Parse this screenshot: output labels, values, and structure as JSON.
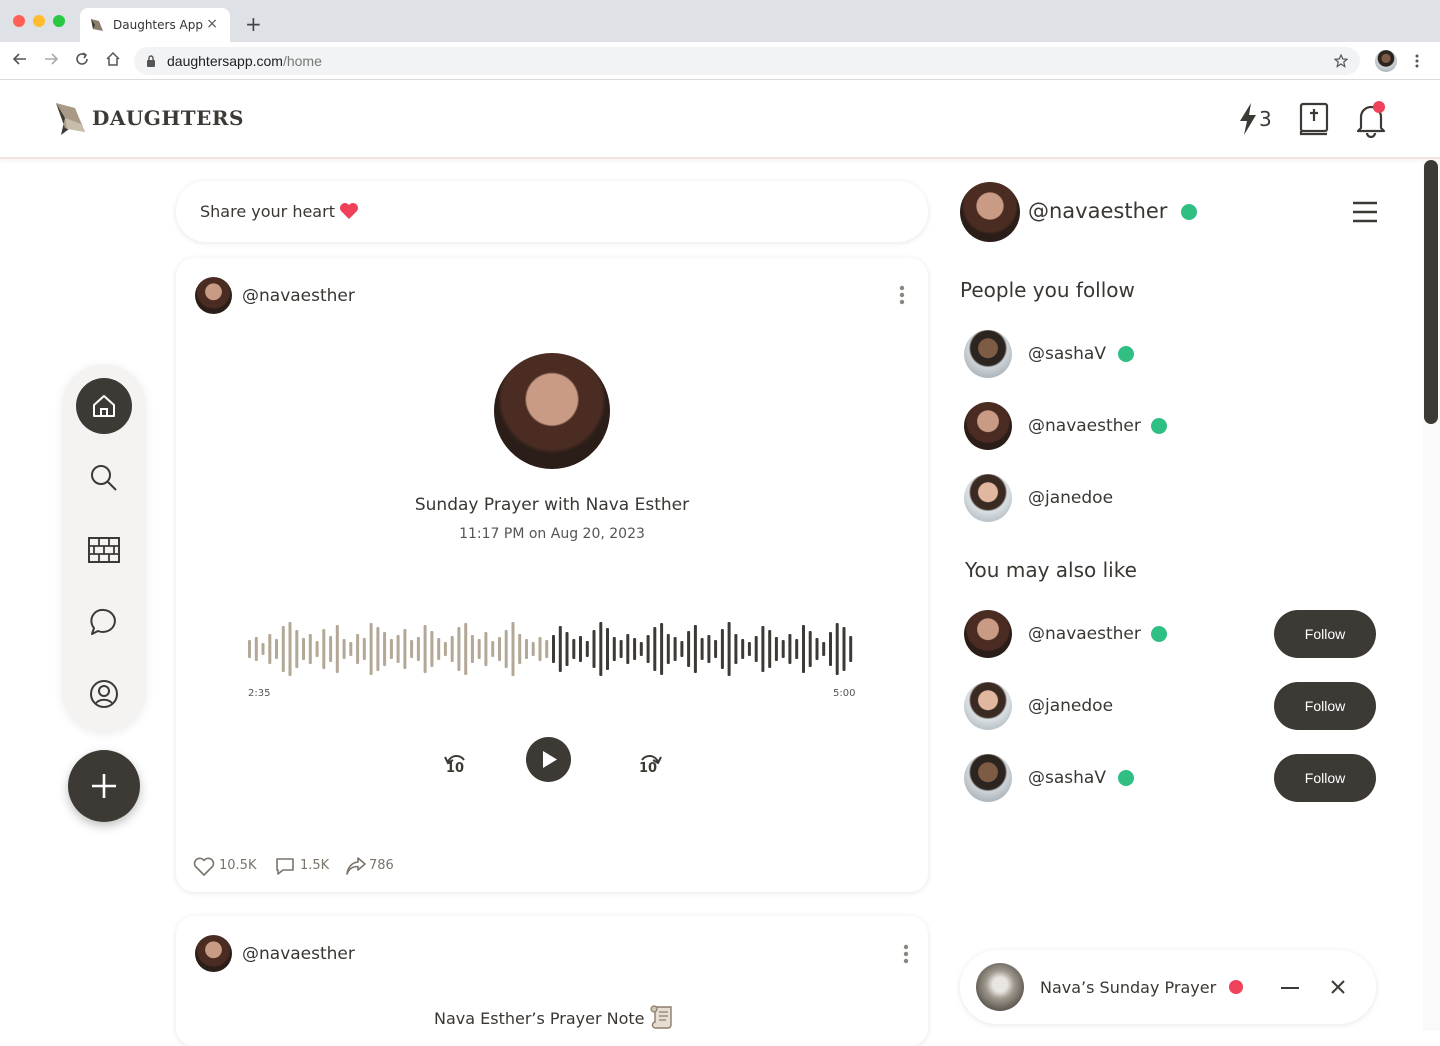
{
  "browser": {
    "tab_title": "Daughters App",
    "tab_close": "×",
    "new_tab": "+",
    "url_host": "daughtersapp.com",
    "url_path": "/home"
  },
  "header": {
    "brand": "DAUGHTERS",
    "streak_count": "3",
    "notification_dot_color": "#f0415a"
  },
  "composer": {
    "placeholder": "Share your heart"
  },
  "post1": {
    "username": "@navaesther",
    "title": "Sunday Prayer with Nava Esther",
    "timestamp": "11:17 PM on Aug 20, 2023",
    "elapsed": "2:35",
    "duration": "5:00",
    "progress_fraction": 0.5,
    "skip_back": "10",
    "skip_forward": "10",
    "likes": "10.5K",
    "comments": "1.5K",
    "shares": "786"
  },
  "post2": {
    "username": "@navaesther",
    "title": "Nava Esther’s Prayer Note"
  },
  "profile": {
    "username": "@navaesther"
  },
  "following": {
    "heading": "People you follow",
    "users": [
      {
        "username": "@sashaV",
        "online": true
      },
      {
        "username": "@navaesther",
        "online": true
      },
      {
        "username": "@janedoe",
        "online": false
      }
    ]
  },
  "suggestions": {
    "heading": "You may also like",
    "users": [
      {
        "username": "@navaesther",
        "online": true,
        "button": "Follow"
      },
      {
        "username": "@janedoe",
        "online": false,
        "button": "Follow"
      },
      {
        "username": "@sashaV",
        "online": true,
        "button": "Follow"
      }
    ]
  },
  "mini_player": {
    "title": "Nava’s Sunday Prayer",
    "live_color": "#f0415a"
  },
  "colors": {
    "accent_dark": "#3d3a35",
    "online": "#2fbf82",
    "waveform_played": "#b3a796",
    "waveform_unplayed": "#3d3a35"
  }
}
